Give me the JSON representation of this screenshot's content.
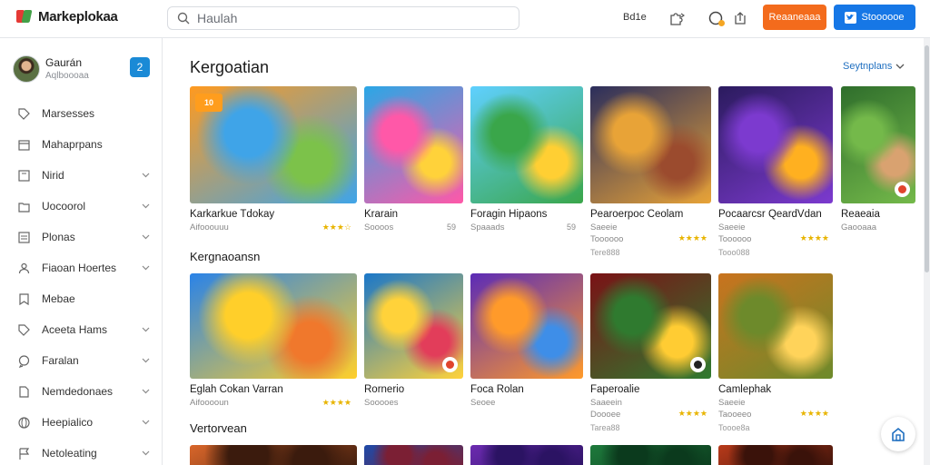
{
  "app": {
    "name": "Markeplokaa"
  },
  "search": {
    "placeholder": "Haulah"
  },
  "topbar": {
    "link": "Bd1e",
    "btn_orange": "Reaaneaaa",
    "btn_blue": "Stoooooe"
  },
  "profile": {
    "name": "Gaurán",
    "subtitle": "Aqlboooaa",
    "badge": "2"
  },
  "sidebar": {
    "items": [
      {
        "label": "Marsesses",
        "icon": "tag-icon",
        "chevron": false
      },
      {
        "label": "Mahaprpans",
        "icon": "calendar-icon",
        "chevron": false
      },
      {
        "label": "Nirid",
        "icon": "grid-icon",
        "chevron": true
      },
      {
        "label": "Uocoorol",
        "icon": "folder-icon",
        "chevron": true
      },
      {
        "label": "Plonas",
        "icon": "list-icon",
        "chevron": true
      },
      {
        "label": "Fiaoan Hoertes",
        "icon": "user-icon",
        "chevron": true
      },
      {
        "label": "Mebae",
        "icon": "bookmark-icon",
        "chevron": false
      },
      {
        "label": "Aceeta Hams",
        "icon": "tag-icon",
        "chevron": true
      },
      {
        "label": "Faralan",
        "icon": "chat-icon",
        "chevron": true
      },
      {
        "label": "Nemdedonaes",
        "icon": "doc-icon",
        "chevron": true
      },
      {
        "label": "Heepialico",
        "icon": "globe-icon",
        "chevron": true
      },
      {
        "label": "Netoleating",
        "icon": "flag-icon",
        "chevron": true
      }
    ]
  },
  "main": {
    "title": "Kergoatian",
    "see_all": "Seytnplans",
    "sections": [
      "Kergnaoansn",
      "Vertorvean"
    ]
  },
  "row1": [
    {
      "title": "Karkarkue Tdokay",
      "sub": "Aifooouuu",
      "rating": "★★★☆",
      "art": [
        "#ff9a1f",
        "#3fa4e8",
        "#7cc24a"
      ],
      "top_badge": "10"
    },
    {
      "title": "Krarain",
      "sub": "Soooos",
      "meta": "59",
      "art": [
        "#2aa7e6",
        "#ff58a8",
        "#ffd23a"
      ]
    },
    {
      "title": "Foragin Hipaons",
      "sub": "Spaaads",
      "meta": "59",
      "art": [
        "#5fd0ff",
        "#3aa64a",
        "#ffcf33"
      ]
    },
    {
      "title": "Pearoerpoc Ceolam",
      "sub": "Saeeie",
      "sub2": "Toooooo",
      "extra": "Tere888",
      "rating": "★★★★",
      "art": [
        "#2b2e5c",
        "#e8a337",
        "#9b4b2e"
      ]
    },
    {
      "title": "Pocaarcsr QeardVdan",
      "sub": "Saeeie",
      "sub2": "Toooooo",
      "extra": "Tooo088",
      "rating": "★★★★",
      "art": [
        "#2b1b5e",
        "#7c3acf",
        "#ffb020"
      ]
    },
    {
      "title": "Reaeaia",
      "sub": "Gaooaaa",
      "art": [
        "#2f6e2c",
        "#74b94a",
        "#d9a270"
      ]
    }
  ],
  "row2": [
    {
      "title": "Eglah Cokan Varran",
      "sub": "Aifooooun",
      "rating": "★★★★",
      "art": [
        "#2a83e8",
        "#ffcf2a",
        "#f0782c"
      ]
    },
    {
      "title": "Rornerio",
      "sub": "Sooooes",
      "art": [
        "#1a77c9",
        "#ffd23a",
        "#e23d5a"
      ]
    },
    {
      "title": "Foca Rolan",
      "sub": "Seoee",
      "art": [
        "#5b2bb7",
        "#ff9a2a",
        "#3e8ee8"
      ]
    },
    {
      "title": "Faperoalie",
      "sub": "Saaeein",
      "sub2": "Doooee",
      "extra": "Tarea88",
      "rating": "★★★★",
      "art": [
        "#7a1216",
        "#2f7a2f",
        "#ffcc33"
      ]
    },
    {
      "title": "Camlephak",
      "sub": "Saeeie",
      "sub2": "Taooeeo",
      "extra": "Toooe8a",
      "rating": "★★★★",
      "art": [
        "#c9731e",
        "#6d8a2b",
        "#ffd35a"
      ]
    }
  ],
  "row3": [
    {
      "art": [
        "#d9662a",
        "#3b1b0d"
      ]
    },
    {
      "art": [
        "#1e4aa8",
        "#7b1f34"
      ]
    },
    {
      "art": [
        "#6c2bb0",
        "#2b1363"
      ]
    },
    {
      "art": [
        "#1e7a3c",
        "#0b3a1d"
      ]
    },
    {
      "art": [
        "#b83a1a",
        "#3a120a"
      ]
    }
  ]
}
